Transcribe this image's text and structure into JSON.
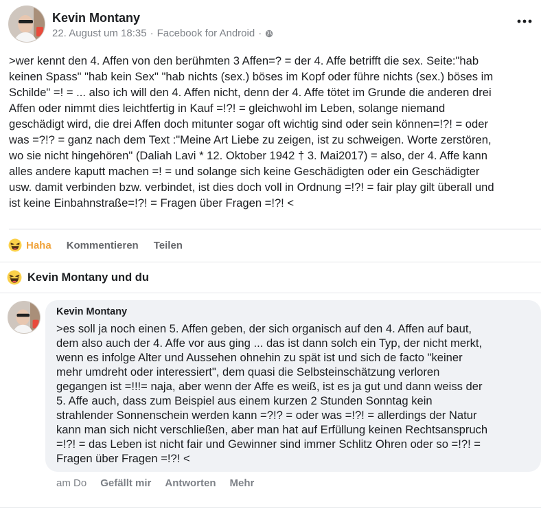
{
  "post": {
    "author": "Kevin Montany",
    "date": "22. August um 18:35",
    "separator": "·",
    "source": "Facebook for Android",
    "privacy_icon": "globe-icon",
    "more_icon": "more-horizontal-icon",
    "text": ">wer kennt den 4. Affen von den berühmten 3 Affen=? = der 4. Affe betrifft die sex. Seite:\"hab\nkeinen Spass\" \"hab kein Sex\" \"hab nichts (sex.) böses im Kopf oder führe nichts (sex.) böses im\nSchilde\" =! = ... also ich will den 4. Affen nicht, denn der 4. Affe tötet im Grunde die anderen drei\nAffen oder nimmt dies leichtfertig in Kauf =!?! = gleichwohl im Leben, solange niemand\ngeschädigt wird, die drei Affen doch mitunter sogar oft wichtig sind oder sein können=!?! = oder\nwas =?!? = ganz nach dem Text :\"Meine Art Liebe zu zeigen, ist zu schweigen. Worte zerstören,\nwo sie nicht hingehören\" (Daliah Lavi * 12. Oktober 1942 † 3. Mai2017) = also, der 4. Affe kann\nalles andere kaputt machen =! = und solange sich keine Geschädigten oder ein Geschädigter\nusw. damit verbinden bzw. verbindet, ist dies doch voll in Ordnung =!?! = fair play gilt überall und\nist keine Einbahnstraße=!?! = Fragen über Fragen =!?! <"
  },
  "actions": {
    "haha": "Haha",
    "comment": "Kommentieren",
    "share": "Teilen",
    "haha_color": "#f0a33b"
  },
  "reactions": {
    "summary": "Kevin Montany und du",
    "icon": "haha-emoji-icon"
  },
  "comment": {
    "author": "Kevin Montany",
    "text": ">es soll ja noch einen 5. Affen geben, der sich organisch auf den 4. Affen auf baut,\ndem also auch der 4. Affe vor aus ging ... das ist dann solch ein Typ, der nicht merkt,\nwenn es infolge Alter und Aussehen ohnehin zu spät ist und sich de facto \"keiner\nmehr umdreht oder interessiert\", dem quasi die Selbsteinschätzung verloren\ngegangen ist =!!!= naja, aber wenn der Affe es weiß, ist es ja gut und dann weiss der\n5. Affe auch, dass zum Beispiel aus einem kurzen 2 Stunden Sonntag kein\nstrahlender Sonnenschein werden kann =?!? = oder was =!?! = allerdings der Natur\nkann man sich nicht verschließen, aber man hat auf Erfüllung keinen Rechtsanspruch\n=!?! = das Leben ist nicht fair und Gewinner sind immer Schlitz Ohren oder so =!?! =\nFragen über Fragen =!?! <",
    "time": "am Do",
    "like": "Gefällt mir",
    "reply": "Antworten",
    "more": "Mehr"
  }
}
